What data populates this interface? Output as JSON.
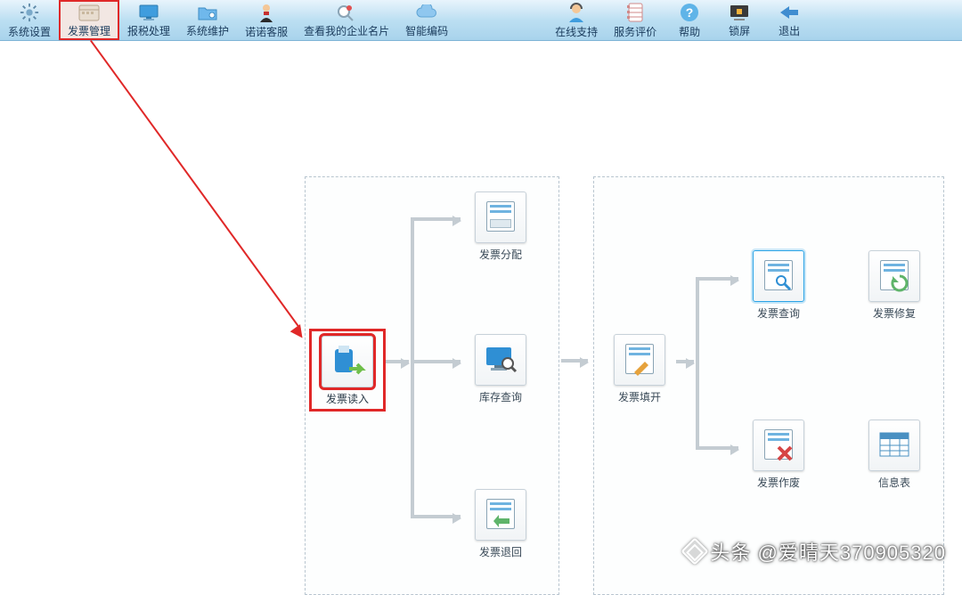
{
  "toolbar": {
    "items": [
      {
        "label": "系统设置",
        "icon": "gear"
      },
      {
        "label": "发票管理",
        "icon": "calendar",
        "highlight": true
      },
      {
        "label": "报税处理",
        "icon": "monitor"
      },
      {
        "label": "系统维护",
        "icon": "folder"
      },
      {
        "label": "诺诺客服",
        "icon": "agent"
      },
      {
        "label": "查看我的企业名片",
        "icon": "card"
      },
      {
        "label": "智能编码",
        "icon": "cloud"
      }
    ],
    "right_items": [
      {
        "label": "在线支持",
        "icon": "support"
      },
      {
        "label": "服务评价",
        "icon": "notebook"
      },
      {
        "label": "帮助",
        "icon": "help"
      },
      {
        "label": "锁屏",
        "icon": "lock"
      },
      {
        "label": "退出",
        "icon": "exit"
      }
    ]
  },
  "flow": {
    "left_panel": {
      "root": {
        "label": "发票读入",
        "highlight": "red"
      },
      "children": [
        {
          "label": "发票分配"
        },
        {
          "label": "库存查询"
        },
        {
          "label": "发票退回"
        }
      ]
    },
    "right_panel": {
      "root": {
        "label": "发票填开"
      },
      "children": [
        {
          "label": "发票查询",
          "highlight": "blue"
        },
        {
          "label": "发票修复"
        },
        {
          "label": "发票作废"
        },
        {
          "label": "信息表"
        }
      ]
    }
  },
  "watermark": "头条 @爱晴天370905320"
}
